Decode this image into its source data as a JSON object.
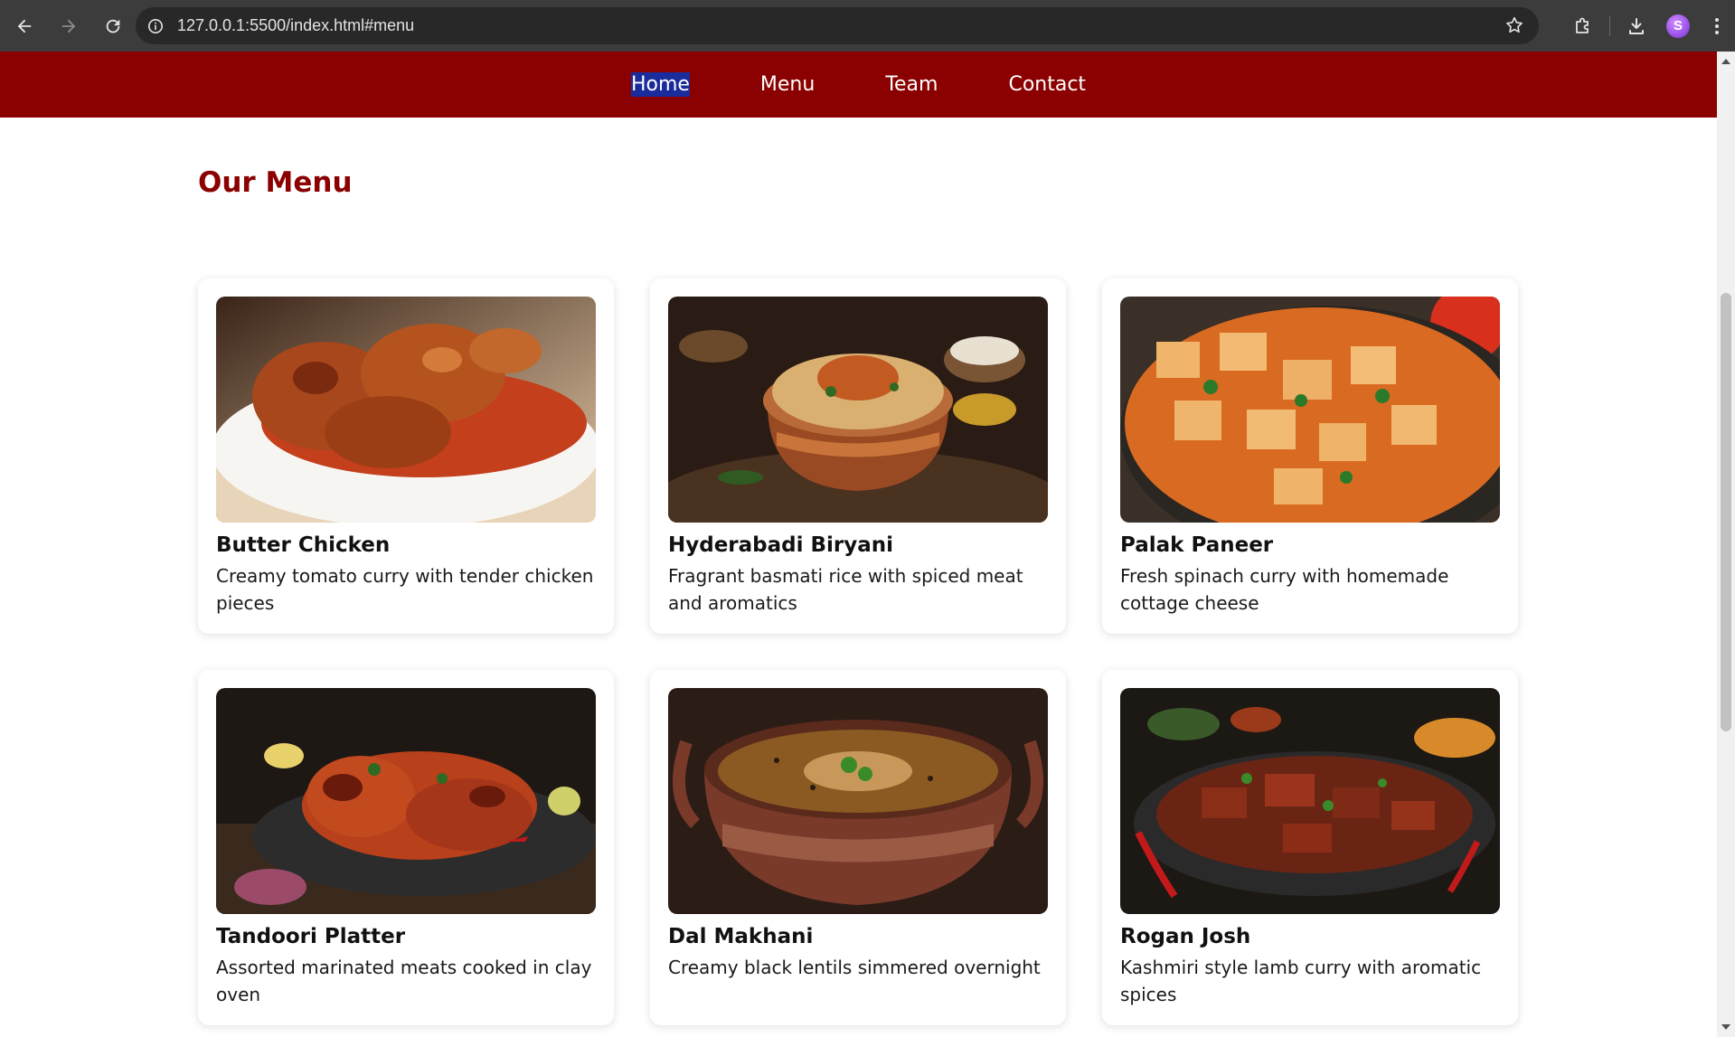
{
  "browser": {
    "url": "127.0.0.1:5500/index.html#menu",
    "avatar_letter": "S",
    "icons": [
      "back-icon",
      "forward-icon",
      "reload-icon",
      "site-info-icon",
      "bookmark-star-icon",
      "extensions-icon",
      "download-icon",
      "profile-avatar",
      "more-menu-icon"
    ]
  },
  "nav": {
    "items": [
      {
        "label": "Home"
      },
      {
        "label": "Menu"
      },
      {
        "label": "Team"
      },
      {
        "label": "Contact"
      }
    ],
    "selected": "Home"
  },
  "menu": {
    "title": "Our Menu",
    "items": [
      {
        "name": "Butter Chicken",
        "desc": "Creamy tomato curry with tender chicken pieces"
      },
      {
        "name": "Hyderabadi Biryani",
        "desc": "Fragrant basmati rice with spiced meat and aromatics"
      },
      {
        "name": "Palak Paneer",
        "desc": "Fresh spinach curry with homemade cottage cheese"
      },
      {
        "name": "Tandoori Platter",
        "desc": "Assorted marinated meats cooked in clay oven"
      },
      {
        "name": "Dal Makhani",
        "desc": "Creamy black lentils simmered overnight"
      },
      {
        "name": "Rogan Josh",
        "desc": "Kashmiri style lamb curry with aromatic spices"
      }
    ]
  },
  "colors": {
    "brand": "#8b0000",
    "chrome": "#3c3c3c",
    "selection": "#1a2c9c"
  }
}
